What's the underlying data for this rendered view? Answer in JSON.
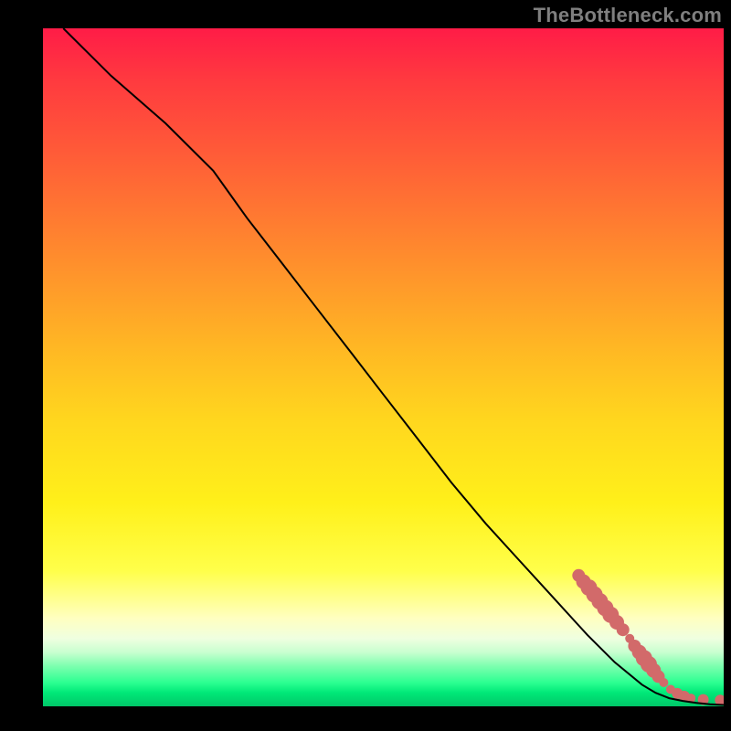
{
  "watermark": "TheBottleneck.com",
  "chart_data": {
    "type": "line",
    "title": "",
    "xlabel": "",
    "ylabel": "",
    "xlim": [
      0,
      100
    ],
    "ylim": [
      0,
      100
    ],
    "line_series": {
      "name": "curve",
      "x": [
        3,
        10,
        18,
        25,
        30,
        35,
        40,
        45,
        50,
        55,
        60,
        65,
        70,
        75,
        80,
        84,
        88,
        90,
        92,
        94,
        96,
        98,
        100
      ],
      "y": [
        100,
        93,
        86,
        79,
        72,
        65.5,
        59,
        52.5,
        46,
        39.5,
        33,
        27,
        21.5,
        16,
        10.5,
        6.5,
        3.2,
        2.0,
        1.2,
        0.8,
        0.5,
        0.3,
        0.2
      ]
    },
    "scatter_series": {
      "name": "markers",
      "color": "#d26a6a",
      "points": [
        {
          "x": 78.7,
          "y": 19.3,
          "r": 7
        },
        {
          "x": 79.4,
          "y": 18.4,
          "r": 8
        },
        {
          "x": 80.2,
          "y": 17.5,
          "r": 9
        },
        {
          "x": 81.0,
          "y": 16.5,
          "r": 9
        },
        {
          "x": 81.8,
          "y": 15.5,
          "r": 9
        },
        {
          "x": 82.6,
          "y": 14.5,
          "r": 9
        },
        {
          "x": 83.4,
          "y": 13.5,
          "r": 9
        },
        {
          "x": 84.3,
          "y": 12.4,
          "r": 8
        },
        {
          "x": 85.2,
          "y": 11.3,
          "r": 7
        },
        {
          "x": 86.2,
          "y": 10.0,
          "r": 5
        },
        {
          "x": 86.9,
          "y": 8.9,
          "r": 7
        },
        {
          "x": 87.6,
          "y": 8.0,
          "r": 8
        },
        {
          "x": 88.3,
          "y": 7.1,
          "r": 9
        },
        {
          "x": 89.0,
          "y": 6.2,
          "r": 9
        },
        {
          "x": 89.7,
          "y": 5.3,
          "r": 8
        },
        {
          "x": 90.4,
          "y": 4.4,
          "r": 7
        },
        {
          "x": 91.2,
          "y": 3.5,
          "r": 5
        },
        {
          "x": 92.2,
          "y": 2.5,
          "r": 5
        },
        {
          "x": 93.2,
          "y": 1.9,
          "r": 6
        },
        {
          "x": 94.2,
          "y": 1.5,
          "r": 6
        },
        {
          "x": 95.2,
          "y": 1.2,
          "r": 5
        },
        {
          "x": 97.0,
          "y": 1.0,
          "r": 6
        },
        {
          "x": 99.5,
          "y": 0.9,
          "r": 6
        }
      ]
    },
    "background_gradient": {
      "stops": [
        {
          "pos": 0.0,
          "color": "#ff1c47"
        },
        {
          "pos": 0.5,
          "color": "#ffd71e"
        },
        {
          "pos": 0.85,
          "color": "#ffffc0"
        },
        {
          "pos": 1.0,
          "color": "#00c768"
        }
      ],
      "direction": "top-to-bottom"
    }
  }
}
